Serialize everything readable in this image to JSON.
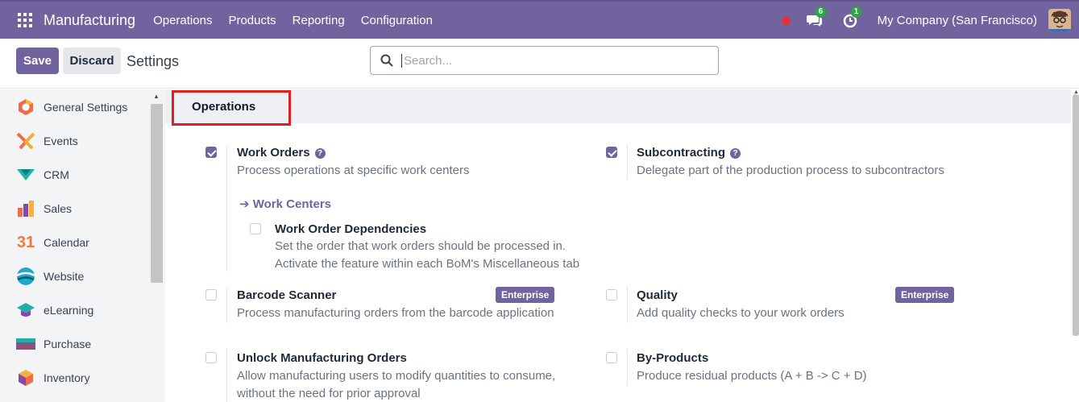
{
  "navbar": {
    "app_name": "Manufacturing",
    "menu": [
      "Operations",
      "Products",
      "Reporting",
      "Configuration"
    ],
    "messages_count": "6",
    "activities_count": "1",
    "company": "My Company (San Francisco)"
  },
  "control": {
    "save_label": "Save",
    "discard_label": "Discard",
    "title": "Settings",
    "search_placeholder": "Search..."
  },
  "sidebar": {
    "items": [
      {
        "label": "General Settings",
        "icon": "general-settings-icon"
      },
      {
        "label": "Events",
        "icon": "events-icon"
      },
      {
        "label": "CRM",
        "icon": "crm-icon"
      },
      {
        "label": "Sales",
        "icon": "sales-icon"
      },
      {
        "label": "Calendar",
        "icon": "calendar-icon"
      },
      {
        "label": "Website",
        "icon": "website-icon"
      },
      {
        "label": "eLearning",
        "icon": "elearning-icon"
      },
      {
        "label": "Purchase",
        "icon": "purchase-icon"
      },
      {
        "label": "Inventory",
        "icon": "inventory-icon"
      }
    ],
    "calendar_glyph": "31"
  },
  "section": {
    "title": "Operations"
  },
  "settings": {
    "work_orders": {
      "title": "Work Orders",
      "desc": "Process operations at specific work centers",
      "checked": true
    },
    "work_centers_link": "Work Centers",
    "work_order_dependencies": {
      "title": "Work Order Dependencies",
      "desc1": "Set the order that work orders should be processed in.",
      "desc2": "Activate the feature within each BoM's Miscellaneous tab",
      "checked": false
    },
    "subcontracting": {
      "title": "Subcontracting",
      "desc": "Delegate part of the production process to subcontractors",
      "checked": true
    },
    "barcode_scanner": {
      "title": "Barcode Scanner",
      "desc": "Process manufacturing orders from the barcode application",
      "badge": "Enterprise",
      "checked": false
    },
    "quality": {
      "title": "Quality",
      "desc": "Add quality checks to your work orders",
      "badge": "Enterprise",
      "checked": false
    },
    "unlock_mo": {
      "title": "Unlock Manufacturing Orders",
      "desc1": "Allow manufacturing users to modify quantities to consume,",
      "desc2": "without the need for prior approval",
      "checked": false
    },
    "by_products": {
      "title": "By-Products",
      "desc": "Produce residual products (A + B -> C + D)",
      "checked": false
    }
  },
  "colors": {
    "brand": "#71639e",
    "enterprise_badge": "#71639e",
    "badge_green": "#28a745",
    "highlight_red": "#e02020"
  }
}
